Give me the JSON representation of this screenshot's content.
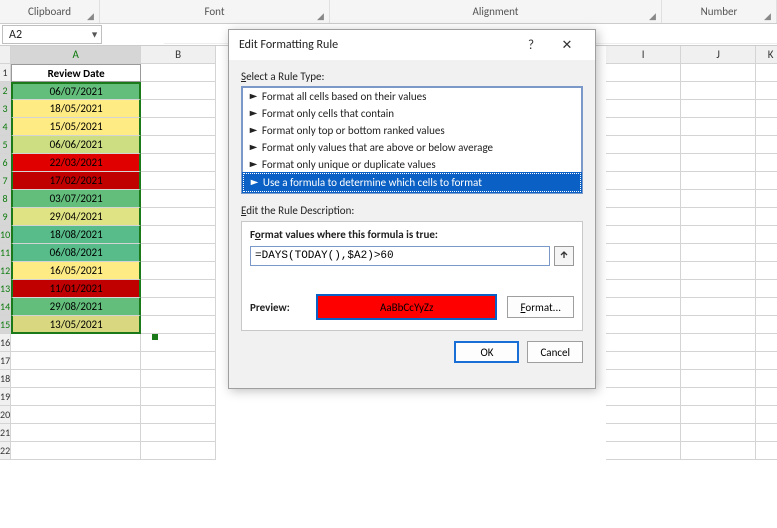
{
  "ribbon": {
    "g1": "Clipboard",
    "g2": "Font",
    "g3": "Alignment",
    "g4": "Number"
  },
  "namebox": "A2",
  "columns": [
    "A",
    "B",
    "I",
    "J",
    "K"
  ],
  "rows": 22,
  "header_cell": "Review Date",
  "data": [
    {
      "v": "06/07/2021",
      "c": "f-lgreen"
    },
    {
      "v": "18/05/2021",
      "c": "f-yellow"
    },
    {
      "v": "15/05/2021",
      "c": "f-yellow"
    },
    {
      "v": "06/06/2021",
      "c": "f-ygreen"
    },
    {
      "v": "22/03/2021",
      "c": "f-red"
    },
    {
      "v": "17/02/2021",
      "c": "f-dred"
    },
    {
      "v": "03/07/2021",
      "c": "f-lgreen"
    },
    {
      "v": "29/04/2021",
      "c": "f-olive"
    },
    {
      "v": "18/08/2021",
      "c": "f-green"
    },
    {
      "v": "06/08/2021",
      "c": "f-green"
    },
    {
      "v": "16/05/2021",
      "c": "f-yellow"
    },
    {
      "v": "11/01/2021",
      "c": "f-dred"
    },
    {
      "v": "29/08/2021",
      "c": "f-dkgrn"
    },
    {
      "v": "13/05/2021",
      "c": "f-myel"
    }
  ],
  "dialog": {
    "title": "Edit Formatting Rule",
    "help": "?",
    "close": "✕",
    "select_label": "Select a Rule Type:",
    "rules": [
      "Format all cells based on their values",
      "Format only cells that contain",
      "Format only top or bottom ranked values",
      "Format only values that are above or below average",
      "Format only unique or duplicate values",
      "Use a formula to determine which cells to format"
    ],
    "selected_rule_index": 5,
    "edit_label": "Edit the Rule Description:",
    "formula_label": "Format values where this formula is true:",
    "formula": "=DAYS(TODAY(),$A2)>60",
    "preview_label": "Preview:",
    "preview_text": "AaBbCcYyZz",
    "format_btn": "Format...",
    "ok": "OK",
    "cancel": "Cancel"
  }
}
